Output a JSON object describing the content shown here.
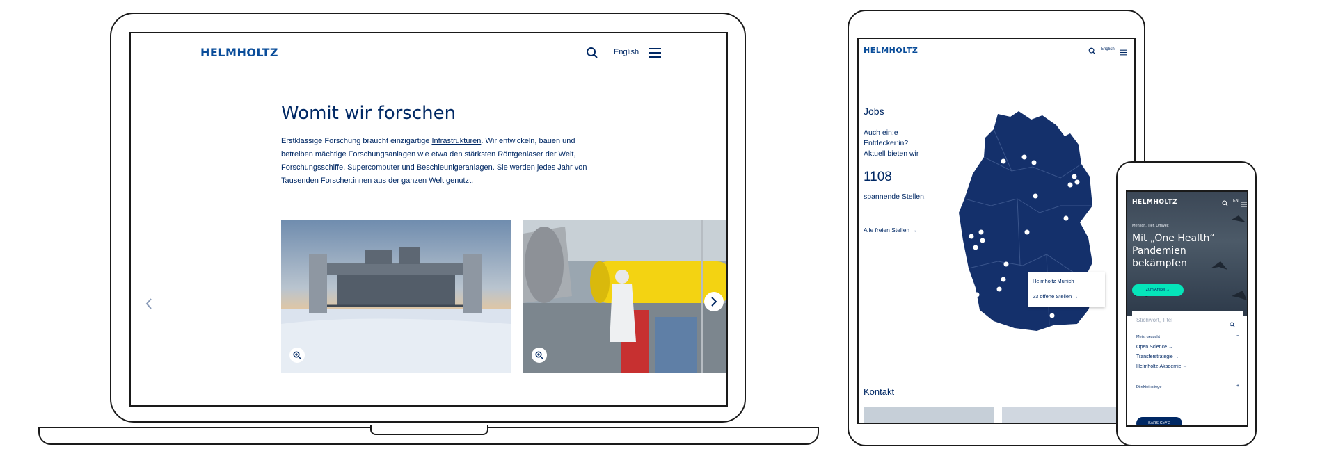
{
  "colors": {
    "brand": "#002864",
    "accent": "#05e5ba",
    "map_fill": "#14306b"
  },
  "laptop": {
    "header": {
      "logo": "HELMHOLTZ",
      "language": "English",
      "search_icon": "search-icon",
      "menu_icon": "hamburger-menu-icon"
    },
    "main": {
      "title": "Womit wir forschen",
      "text_before_link": "Erstklassige Forschung braucht einzigartige ",
      "link": "Infrastrukturen",
      "text_after_link": ". Wir entwickeln, bauen und betreiben mächtige Forschungsanlagen wie etwa den stärksten Röntgenlaser der Welt, Forschungsschiffe, Supercomputer und Beschleunigeranlagen. Sie werden jedes Jahr von Tausenden Forscher:innen aus der ganzen Welt genutzt.",
      "gallery": {
        "prev_icon": "chevron-left-icon",
        "next_icon": "chevron-right-icon",
        "zoom_icon": "zoom-in-icon"
      }
    }
  },
  "tablet": {
    "header": {
      "logo": "HELMHOLTZ",
      "language": "English"
    },
    "jobs": {
      "title": "Jobs",
      "line1": "Auch ein:e",
      "line2": "Entdecker:in?",
      "line3": "Aktuell bieten wir",
      "count": "1108",
      "line4": "spannende Stellen.",
      "all_link": "Alle freien Stellen",
      "popup_name": "Helmholtz Munich",
      "popup_link": "23 offene Stellen"
    },
    "contact_title": "Kontakt"
  },
  "phone": {
    "header": {
      "logo": "HELMHOLTZ",
      "language": "EN"
    },
    "hero": {
      "eyebrow": "Mensch, Tier, Umwelt",
      "title": "Mit „One Health“ Pandemien bekämpfen",
      "cta": "Zum Artikel"
    },
    "search": {
      "placeholder": "Stichwort, Titel",
      "most_searched": "Meist gesucht",
      "items": [
        "Open Science",
        "Transferstrategie",
        "Helmholtz-Akademie"
      ],
      "direct": "Direkteinstiege",
      "badge": "SARS-CoV-2"
    }
  }
}
